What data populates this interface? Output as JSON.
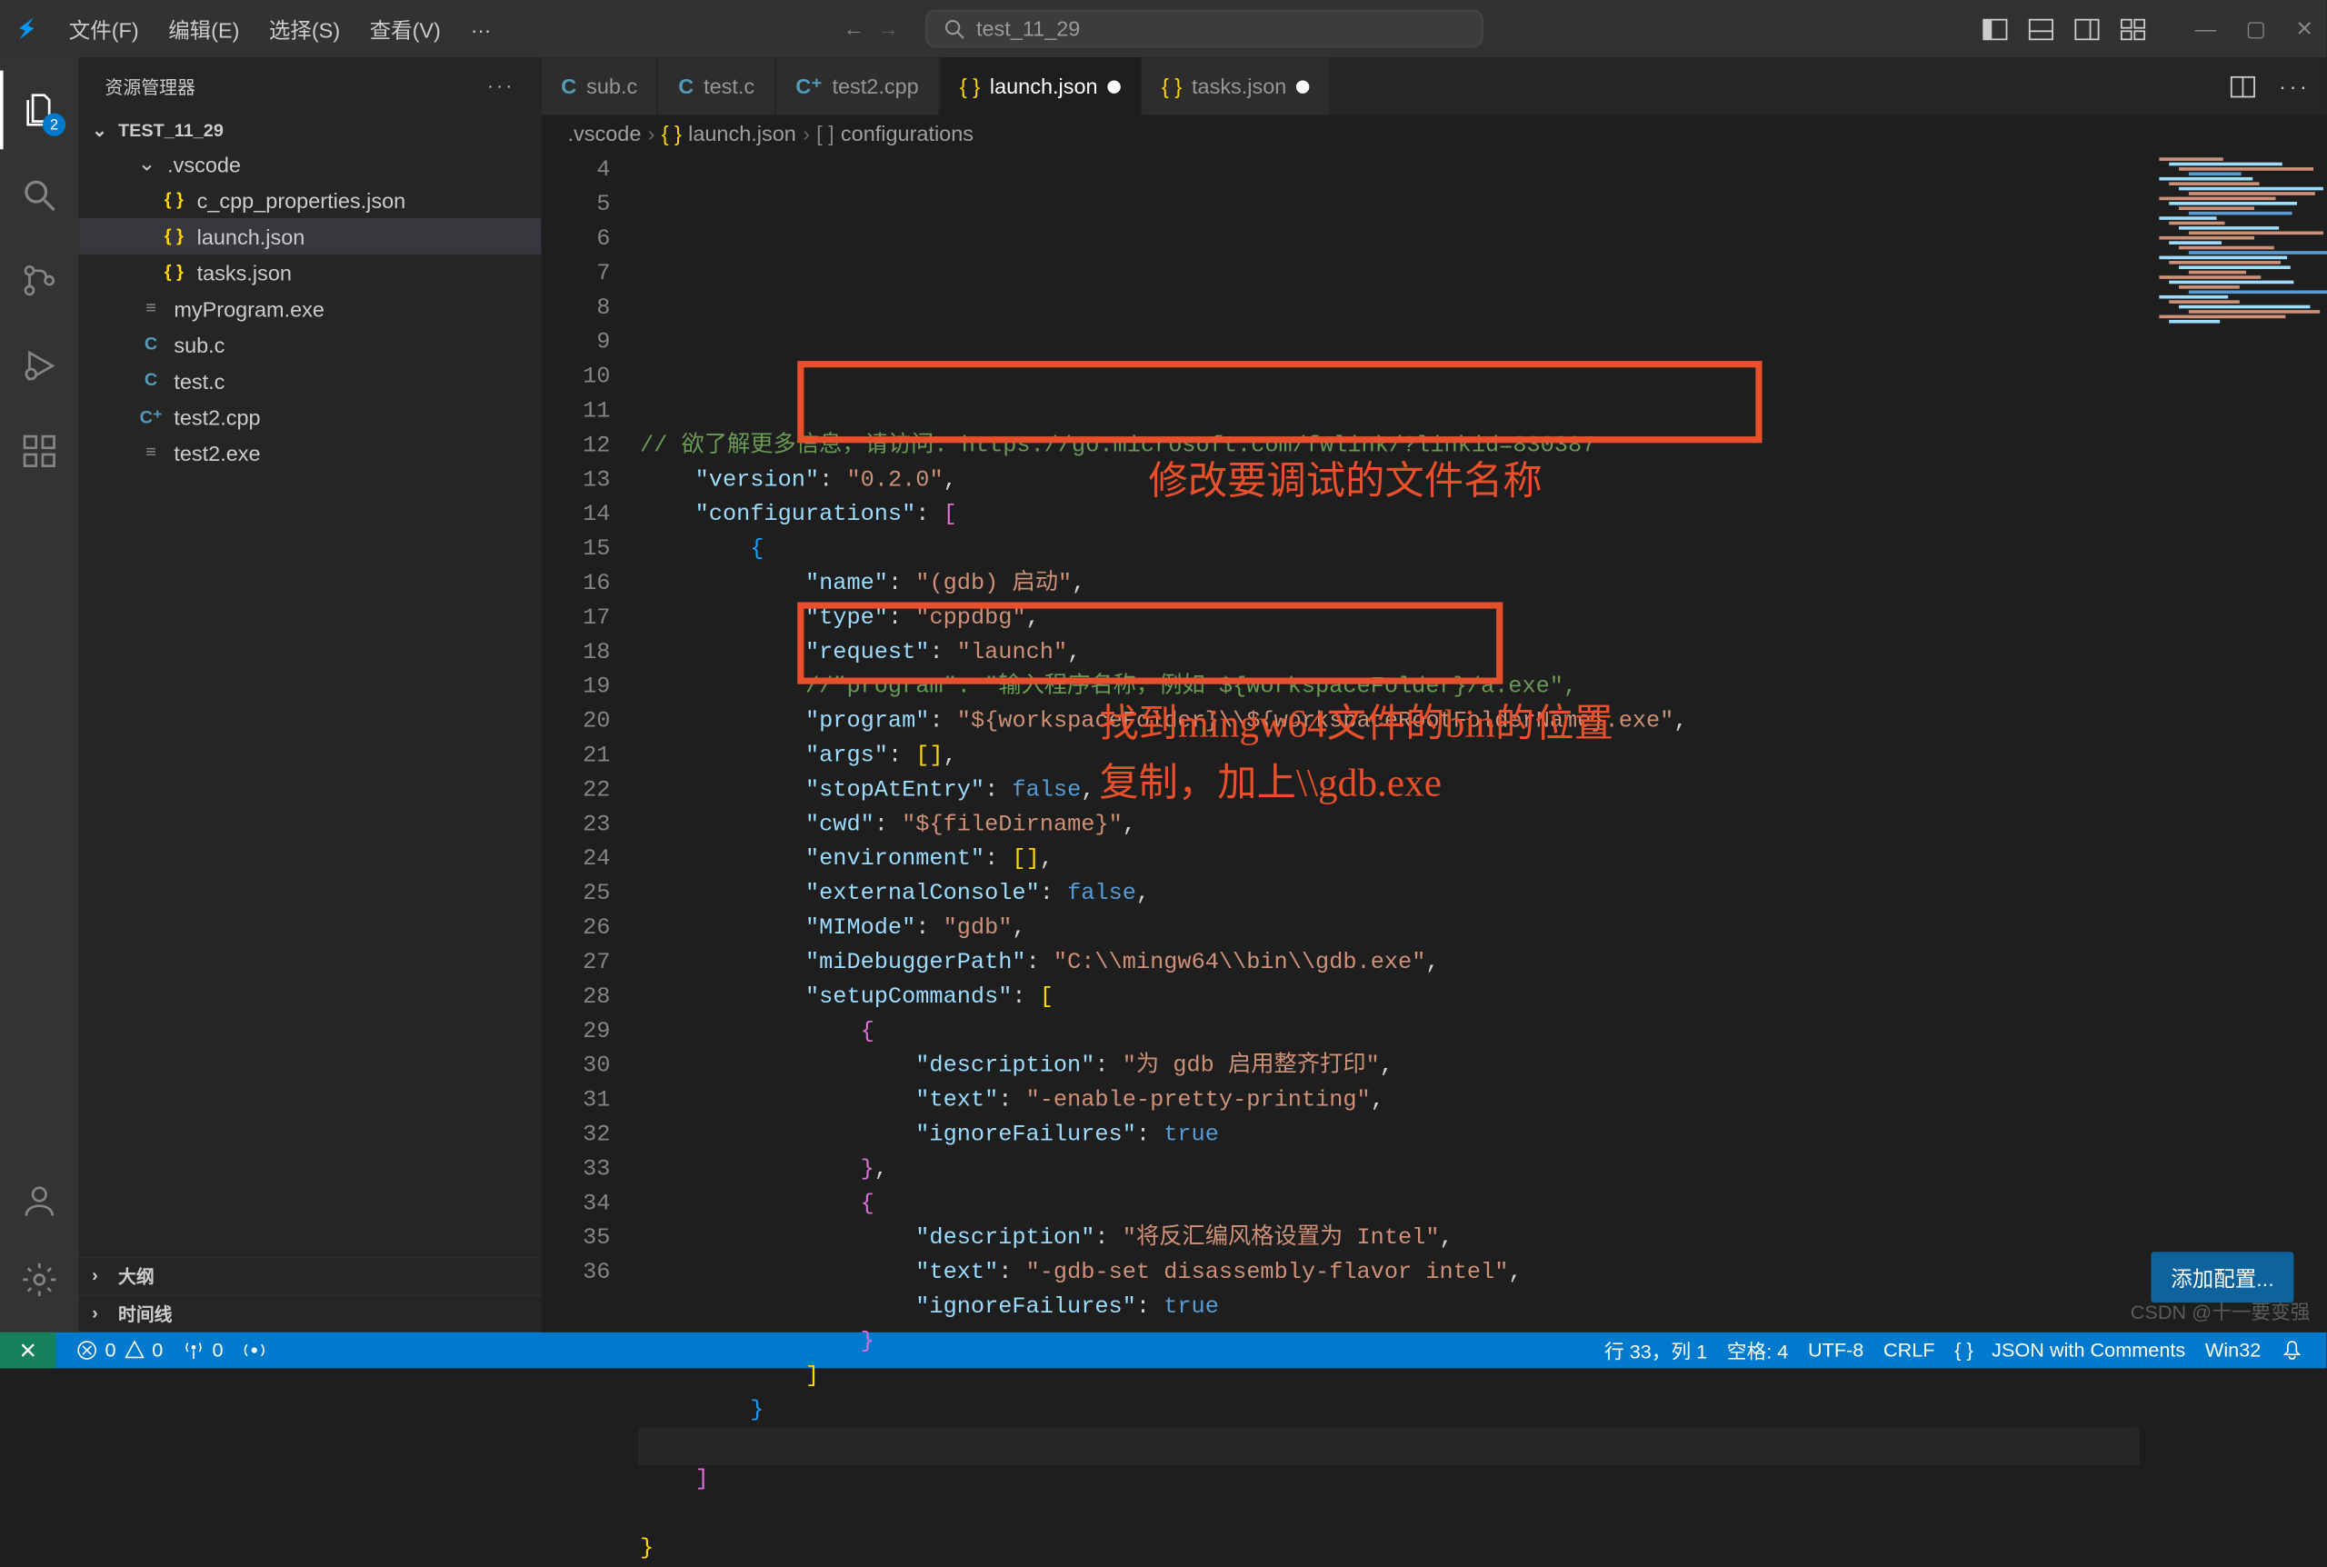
{
  "titlebar": {
    "menus": [
      "文件(F)",
      "编辑(E)",
      "选择(S)",
      "查看(V)",
      "…"
    ],
    "search_text": "test_11_29"
  },
  "activitybar": {
    "explorer_badge": "2"
  },
  "sidebar": {
    "title": "资源管理器",
    "folder": "TEST_11_29",
    "items": [
      {
        "label": ".vscode",
        "type": "folder",
        "indent": 1,
        "expanded": true
      },
      {
        "label": "c_cpp_properties.json",
        "type": "json",
        "indent": 2
      },
      {
        "label": "launch.json",
        "type": "json",
        "indent": 2,
        "selected": true
      },
      {
        "label": "tasks.json",
        "type": "json",
        "indent": 2
      },
      {
        "label": "myProgram.exe",
        "type": "exe",
        "indent": 1
      },
      {
        "label": "sub.c",
        "type": "c",
        "indent": 1
      },
      {
        "label": "test.c",
        "type": "c",
        "indent": 1
      },
      {
        "label": "test2.cpp",
        "type": "cpp",
        "indent": 1
      },
      {
        "label": "test2.exe",
        "type": "exe",
        "indent": 1
      }
    ],
    "outline": "大纲",
    "timeline": "时间线"
  },
  "tabs": [
    {
      "label": "sub.c",
      "icon": "c"
    },
    {
      "label": "test.c",
      "icon": "c"
    },
    {
      "label": "test2.cpp",
      "icon": "cpp"
    },
    {
      "label": "launch.json",
      "icon": "json",
      "active": true,
      "dirty": true
    },
    {
      "label": "tasks.json",
      "icon": "json",
      "dirty": true
    }
  ],
  "breadcrumbs": [
    ".vscode",
    "launch.json",
    "configurations"
  ],
  "code": {
    "lines_start": 4,
    "lines_end": 36,
    "cursor_line": 33,
    "content_json": {
      "version": "0.2.0",
      "configurations": [
        {
          "name": "(gdb) 启动",
          "type": "cppdbg",
          "request": "launch",
          "program_comment": "//\"program\": \"输入程序名称，例如 ${workspaceFolder}/a.exe\",",
          "program": "${workspaceFolder}\\\\${workspaceRootFolderName}.exe",
          "args": [],
          "stopAtEntry": false,
          "cwd": "${fileDirname}",
          "environment": [],
          "externalConsole": false,
          "MIMode": "gdb",
          "miDebuggerPath": "C:\\\\mingw64\\\\bin\\\\gdb.exe",
          "setupCommands": [
            {
              "description": "为 gdb 启用整齐打印",
              "text": "-enable-pretty-printing",
              "ignoreFailures": true
            },
            {
              "description": "将反汇编风格设置为 Intel",
              "text": "-gdb-set disassembly-flavor intel",
              "ignoreFailures": true
            }
          ]
        }
      ]
    }
  },
  "annotations": {
    "a1": "修改要调试的文件名称",
    "a2": "找到mingw64文件的bin的位置",
    "a3": "复制，加上\\\\gdb.exe"
  },
  "add_config_btn": "添加配置...",
  "statusbar": {
    "errors": "0",
    "warnings": "0",
    "ports": "0",
    "line_col": "行 33，列 1",
    "spaces": "空格: 4",
    "encoding": "UTF-8",
    "eol": "CRLF",
    "language": "JSON with Comments",
    "platform": "Win32"
  },
  "watermark": "CSDN @十一要变强"
}
